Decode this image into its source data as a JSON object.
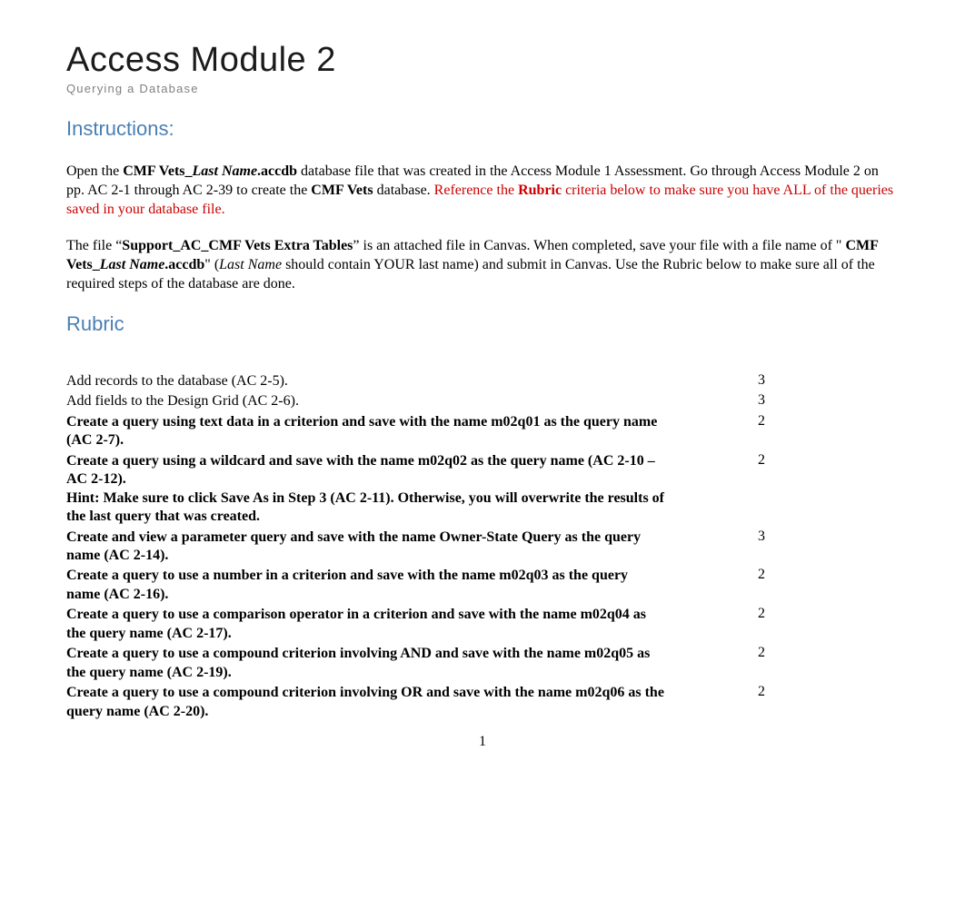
{
  "title": "Access Module 2",
  "subtitle": "Querying a Database",
  "instructions_heading": "Instructions:",
  "para1": {
    "t1": "Open the ",
    "b1": "CMF Vets_",
    "bi1": "Last Name",
    "b2": ".accdb",
    "t2": " database file that was created in the Access Module 1 Assessment. Go through Access Module 2 on pp. AC 2-1 through AC 2-39 to create the ",
    "b3": "CMF Vets",
    "t3": " database. ",
    "r1": "Reference the ",
    "rb1": "Rubric",
    "r2": " criteria below to make sure you have ALL of the queries saved in your database file."
  },
  "para2": {
    "t1": "The file “",
    "b1": "Support_AC_CMF Vets Extra Tables",
    "t2": "” is an attached file in Canvas. When completed, save your file with a file name of \" ",
    "b2": "CMF Vets_",
    "bi1": "Last Name",
    "b3": ".accdb",
    "t3": "\" (",
    "i1": "Last Name",
    "t4": " should contain YOUR last name) and submit in Canvas. Use the Rubric below to make sure all of the required steps of the database are done."
  },
  "rubric_heading": "Rubric",
  "rubric": [
    {
      "desc": "Add records to the database (AC 2-5).",
      "points": "3",
      "bold": false
    },
    {
      "desc": "Add fields to the Design Grid (AC 2-6).",
      "points": "3",
      "bold": false
    },
    {
      "desc": "Create a query using text data in a criterion and save with the name m02q01 as the query name (AC 2-7).",
      "points": "2",
      "bold": true
    },
    {
      "desc": "Create a query using a wildcard and save with the name m02q02 as the query name (AC 2-10 – AC 2-12).\nHint: Make sure to click Save As in Step 3 (AC 2-11). Otherwise, you will overwrite the results of the last query that was created.",
      "points": "2",
      "bold": true
    },
    {
      "desc": "Create and view a parameter query and save with the name Owner-State Query as the query name (AC 2-14).",
      "points": "3",
      "bold": true
    },
    {
      "desc": "Create a query to use a number in a criterion and save with the name m02q03 as the query name (AC 2-16).",
      "points": "2",
      "bold": true
    },
    {
      "desc": "Create a query to use a comparison operator in a criterion and save with the name m02q04 as the query name (AC 2-17).",
      "points": "2",
      "bold": true
    },
    {
      "desc": "Create a query to use a compound criterion involving AND and save with the name m02q05 as the query name (AC 2-19).",
      "points": "2",
      "bold": true
    },
    {
      "desc": "Create a query to use a compound criterion involving OR and save with the name m02q06 as the query name (AC 2-20).",
      "points": "2",
      "bold": true
    }
  ],
  "page_number": "1"
}
